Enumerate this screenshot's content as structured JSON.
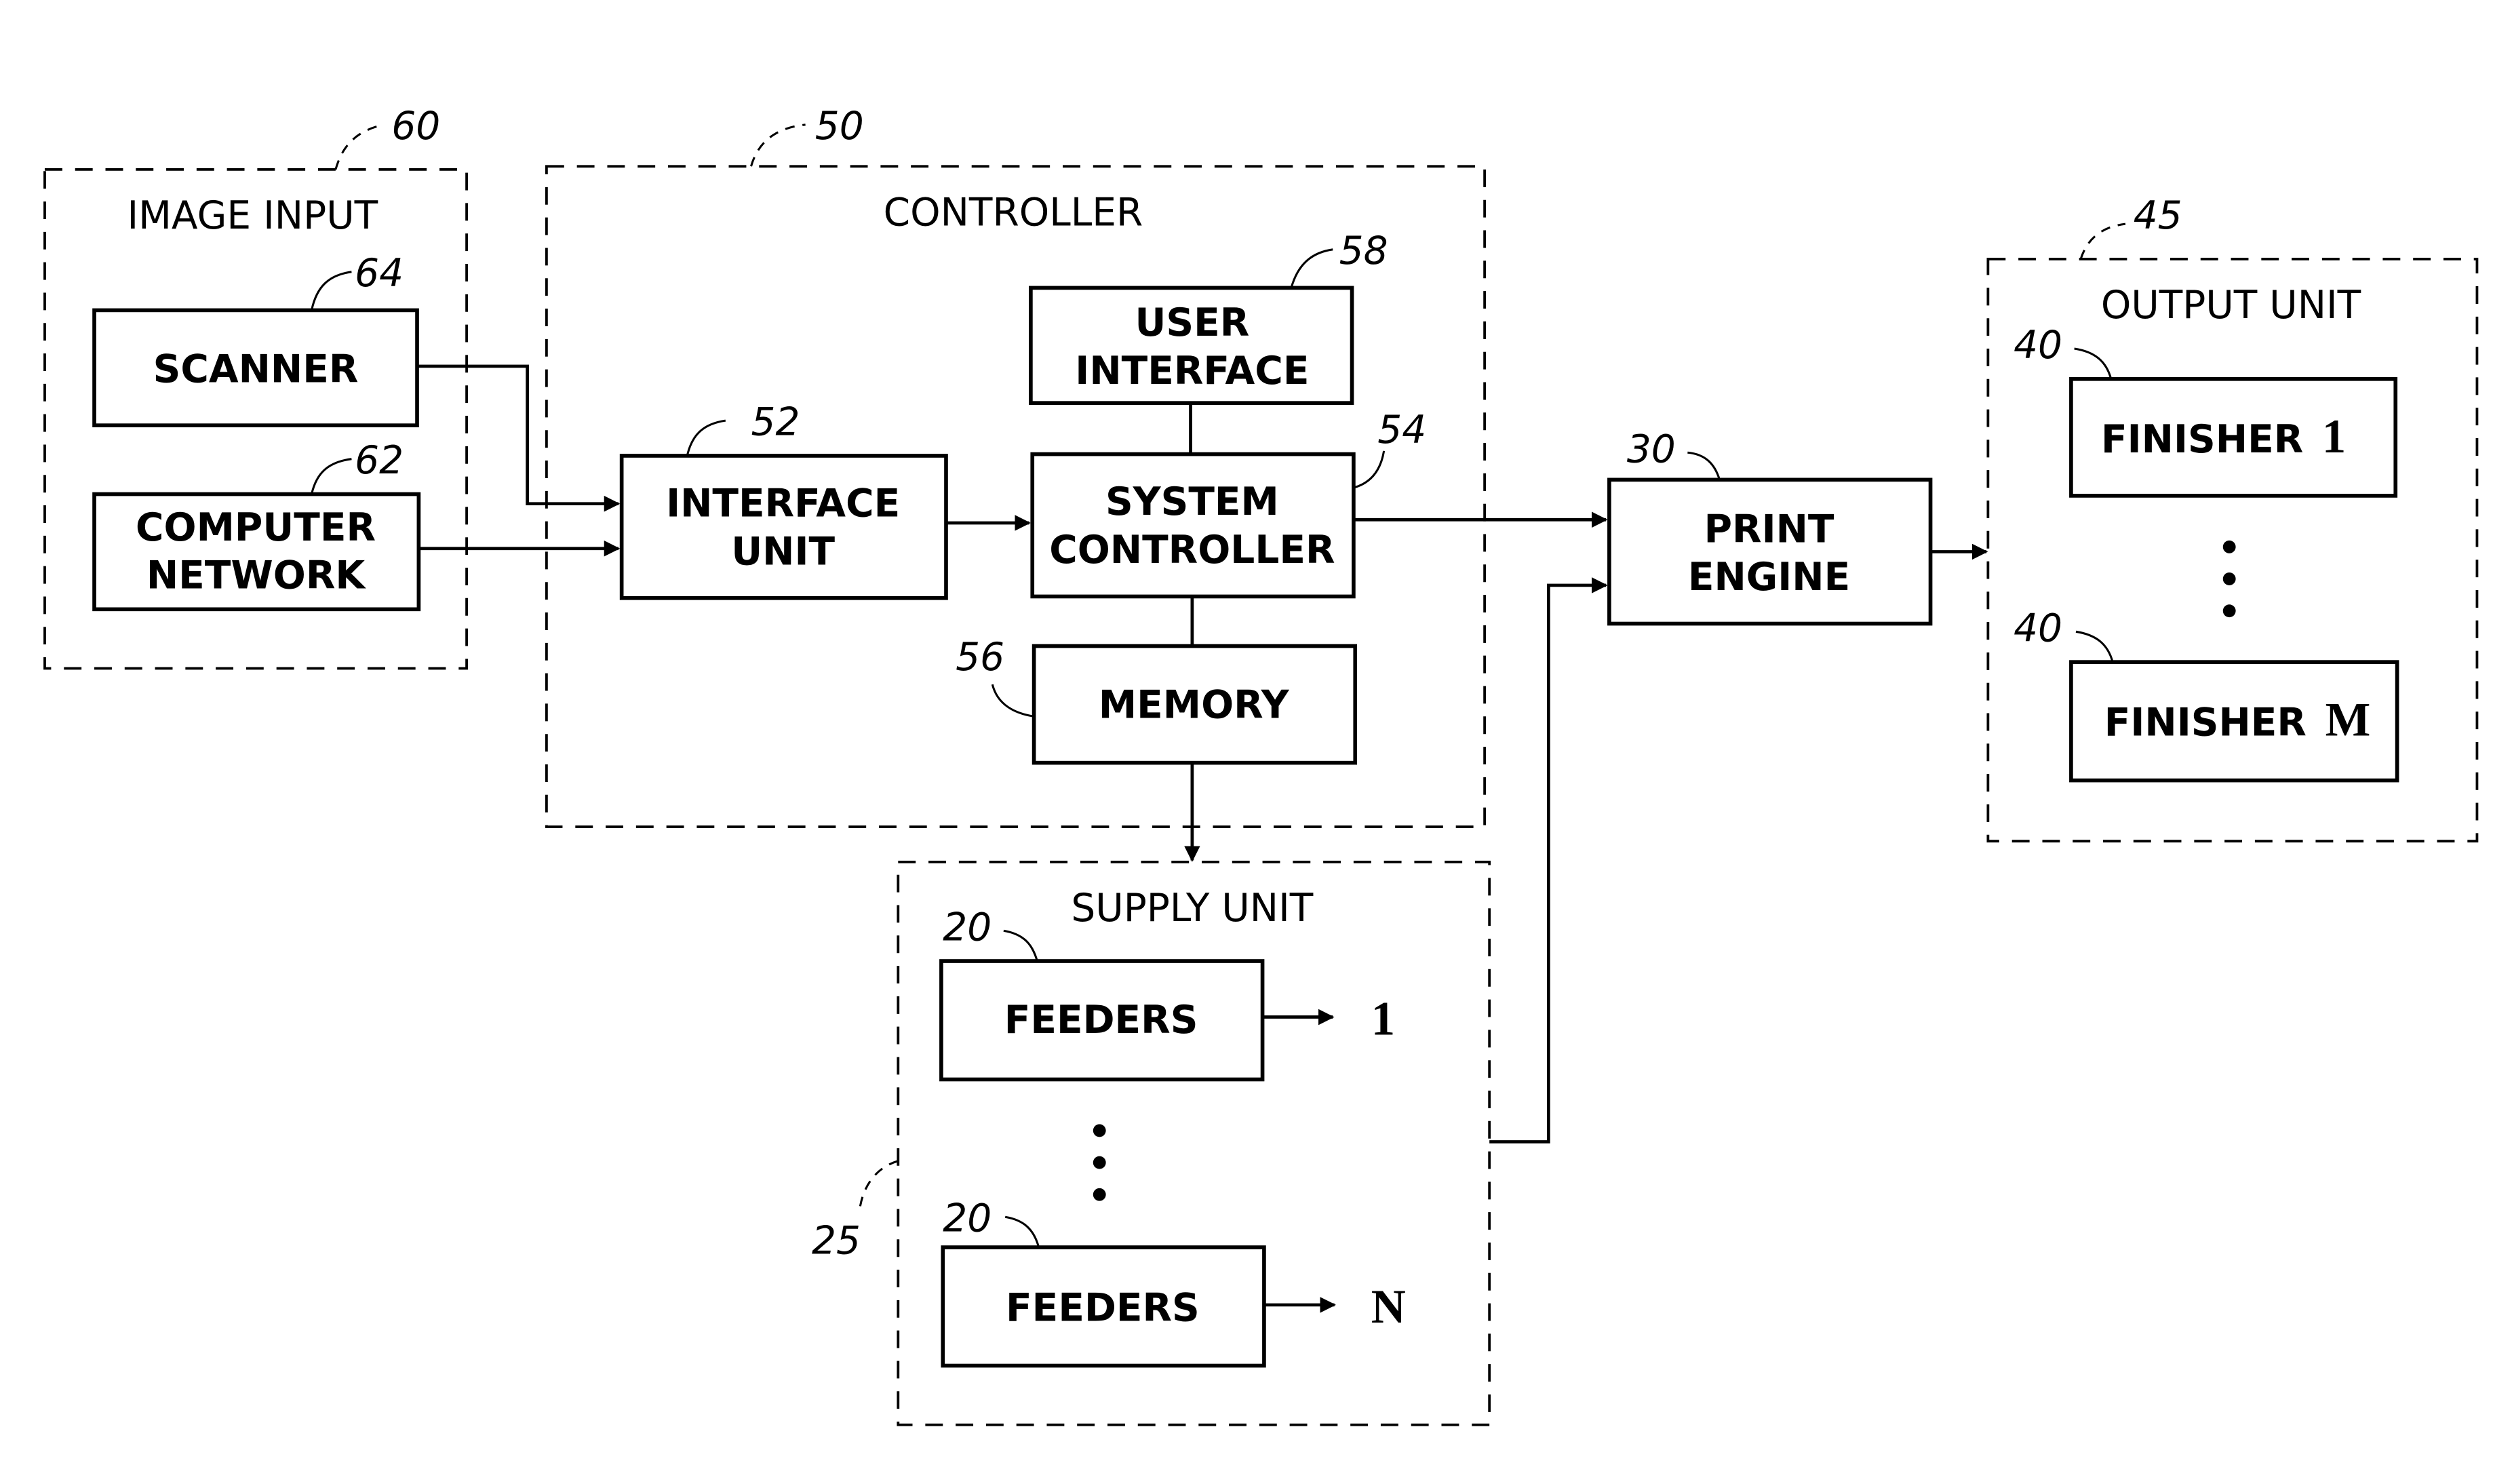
{
  "diagram": {
    "groups": {
      "image_input": {
        "title": "IMAGE INPUT",
        "ref": "60"
      },
      "controller": {
        "title": "CONTROLLER",
        "ref": "50"
      },
      "supply_unit": {
        "title": "SUPPLY UNIT",
        "ref": "25"
      },
      "output_unit": {
        "title": "OUTPUT UNIT",
        "ref": "45"
      }
    },
    "blocks": {
      "scanner": {
        "lines": [
          "SCANNER"
        ],
        "ref": "64"
      },
      "computer_network": {
        "lines": [
          "COMPUTER",
          "NETWORK"
        ],
        "ref": "62"
      },
      "interface_unit": {
        "lines": [
          "INTERFACE",
          "UNIT"
        ],
        "ref": "52"
      },
      "user_interface": {
        "lines": [
          "USER",
          "INTERFACE"
        ],
        "ref": "58"
      },
      "system_controller": {
        "lines": [
          "SYSTEM",
          "CONTROLLER"
        ],
        "ref": "54"
      },
      "memory": {
        "lines": [
          "MEMORY"
        ],
        "ref": "56"
      },
      "feeders_1": {
        "lines": [
          "FEEDERS"
        ],
        "ref": "20",
        "output": "1"
      },
      "feeders_n": {
        "lines": [
          "FEEDERS"
        ],
        "ref": "20",
        "output": "N"
      },
      "print_engine": {
        "lines": [
          "PRINT",
          "ENGINE"
        ],
        "ref": "30"
      },
      "finisher_1": {
        "label": "FINISHER",
        "index": "1",
        "ref": "40"
      },
      "finisher_m": {
        "label": "FINISHER",
        "index": "M",
        "ref": "40"
      }
    },
    "connections": [
      {
        "from": "scanner",
        "to": "interface_unit"
      },
      {
        "from": "computer_network",
        "to": "interface_unit"
      },
      {
        "from": "interface_unit",
        "to": "system_controller"
      },
      {
        "from": "user_interface",
        "to": "system_controller"
      },
      {
        "from": "system_controller",
        "to": "memory"
      },
      {
        "from": "memory",
        "to": "supply_unit"
      },
      {
        "from": "system_controller",
        "to": "print_engine"
      },
      {
        "from": "supply_unit",
        "to": "print_engine"
      },
      {
        "from": "print_engine",
        "to": "output_unit"
      }
    ]
  }
}
